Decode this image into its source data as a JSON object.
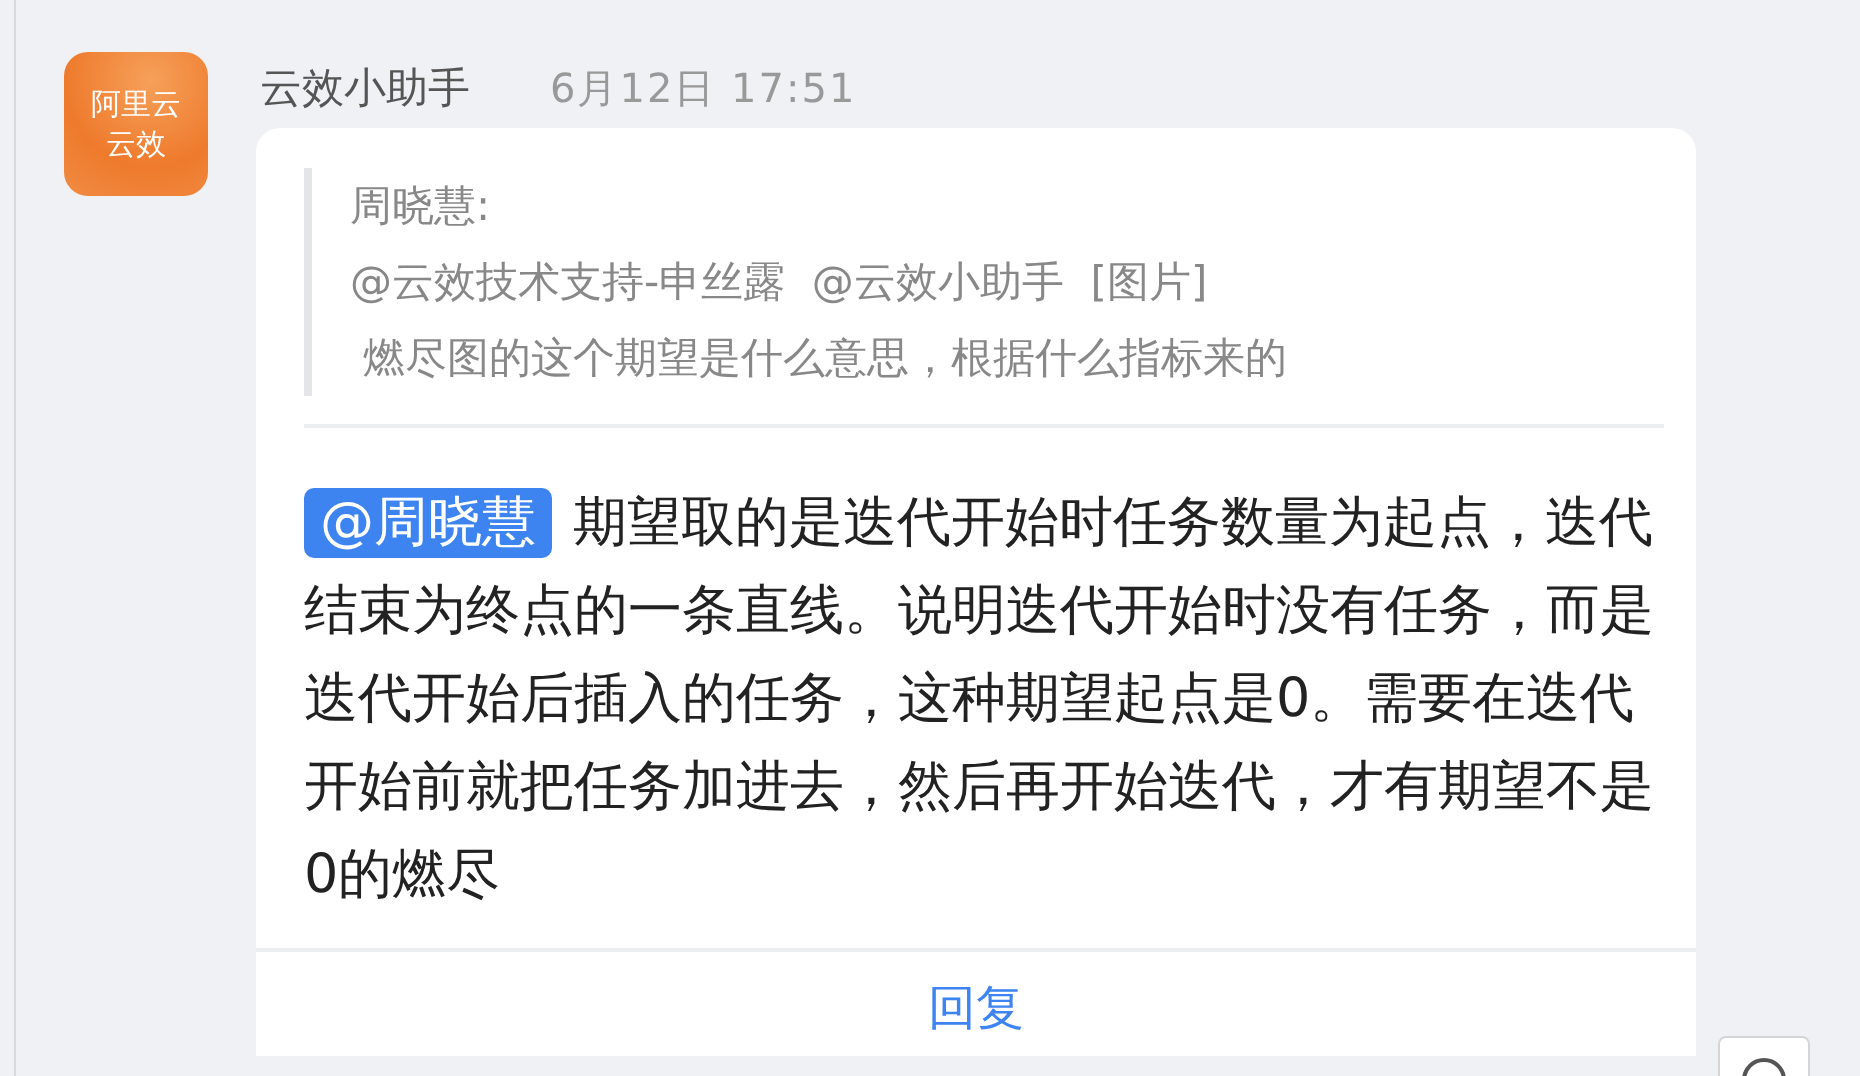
{
  "message": {
    "sender": "云效小助手",
    "time": "6月12日 17:51",
    "avatar_text": [
      "阿里云",
      "云效"
    ],
    "quote": {
      "author": "周晓慧:",
      "lines": [
        "@云效技术支持-申丝露  @云效小助手  [图片]",
        " 燃尽图的这个期望是什么意思，根据什么指标来的"
      ]
    },
    "mention": "@周晓慧",
    "text": "期望取的是迭代开始时任务数量为起点，迭代结束为终点的一条直线。说明迭代开始时没有任务，而是迭代开始后插入的任务，这种期望起点是0。需要在迭代开始前就把任务加进去，然后再开始迭代，才有期望不是0的燃尽",
    "reply_button": "回复"
  }
}
